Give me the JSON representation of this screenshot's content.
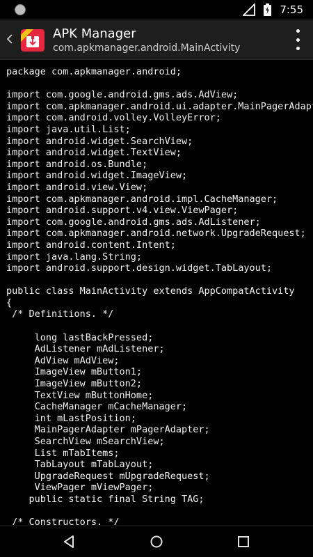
{
  "status_bar": {
    "time": "7:55"
  },
  "app_bar": {
    "title": "APK Manager",
    "subtitle": "com.apkmanager.android.MainActivity"
  },
  "code_lines": [
    "package com.apkmanager.android;",
    "",
    "import com.google.android.gms.ads.AdView;",
    "import com.apkmanager.android.ui.adapter.MainPagerAdapter;",
    "import com.android.volley.VolleyError;",
    "import java.util.List;",
    "import android.widget.SearchView;",
    "import android.widget.TextView;",
    "import android.os.Bundle;",
    "import android.widget.ImageView;",
    "import android.view.View;",
    "import com.apkmanager.android.impl.CacheManager;",
    "import android.support.v4.view.ViewPager;",
    "import com.google.android.gms.ads.AdListener;",
    "import com.apkmanager.android.network.UpgradeRequest;",
    "import android.content.Intent;",
    "import java.lang.String;",
    "import android.support.design.widget.TabLayout;",
    "",
    "public class MainActivity extends AppCompatActivity",
    "{",
    " /* Definitions. */",
    "",
    "     long lastBackPressed;",
    "     AdListener mAdListener;",
    "     AdView mAdView;",
    "     ImageView mButton1;",
    "     ImageView mButton2;",
    "     TextView mButtonHome;",
    "     CacheManager mCacheManager;",
    "     int mLastPosition;",
    "     MainPagerAdapter mPagerAdapter;",
    "     SearchView mSearchView;",
    "     List mTabItems;",
    "     TabLayout mTabLayout;",
    "     UpgradeRequest mUpgradeRequest;",
    "     ViewPager mViewPager;",
    "    public static final String TAG;",
    "",
    " /* Constructors. */"
  ],
  "colors": {
    "background": "#000000",
    "app_bar": "#1e1e1e",
    "code_text": "#f2f2f2",
    "icon_red": "#e5273f",
    "badge_yellow": "#f7c21a"
  },
  "icons": {
    "status_left": "notification-dot-icon",
    "signal": "signal-icon",
    "battery": "battery-charging-icon",
    "back": "chevron-left-icon",
    "app": "apk-manager-app-icon",
    "overflow": "more-vert-icon",
    "nav_back": "nav-back-icon",
    "nav_home": "nav-home-icon",
    "nav_recents": "nav-recents-icon"
  }
}
